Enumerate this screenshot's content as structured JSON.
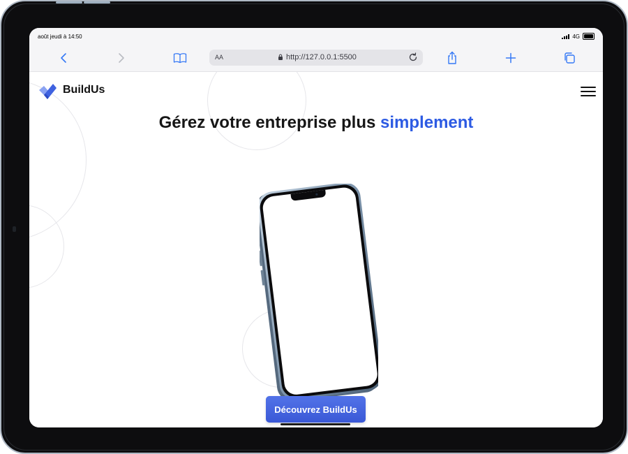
{
  "status_bar": {
    "time": "août jeudi à 14:50",
    "network": "4G"
  },
  "browser": {
    "text_size_label": "AA",
    "url": "http://127.0.0.1:5500",
    "accent_color": "#3478f6"
  },
  "site": {
    "brand": "BuildUs",
    "headline_main": "Gérez votre entreprise plus",
    "headline_accent": "simplement",
    "cta_label": "Découvrez BuildUs",
    "accent_color": "#2d5be3"
  }
}
